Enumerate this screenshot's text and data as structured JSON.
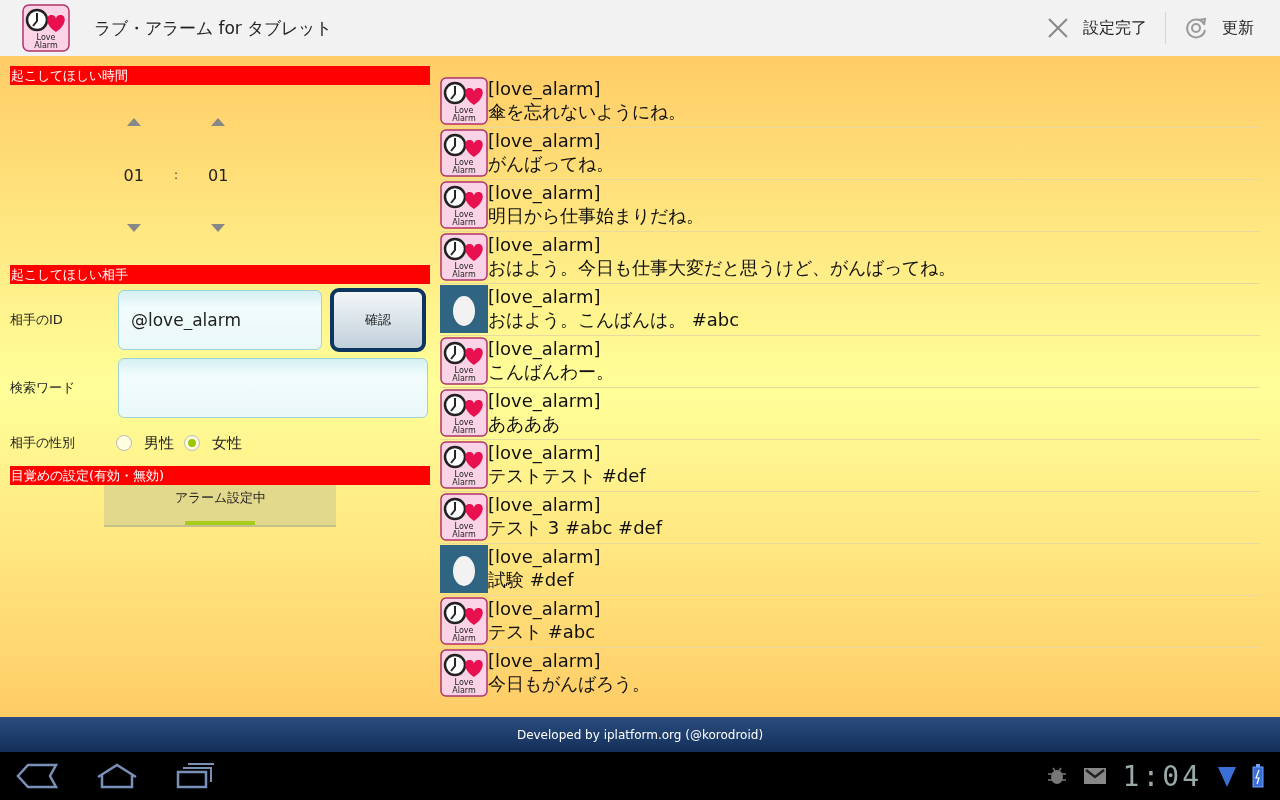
{
  "action_bar": {
    "app_icon_text": [
      "Love",
      "Alarm"
    ],
    "title": "ラブ・アラーム for タブレット",
    "actions": [
      {
        "kind": "close",
        "label": "設定完了"
      },
      {
        "kind": "refresh",
        "label": "更新"
      }
    ]
  },
  "wake_time": {
    "header": "起こしてほしい時間",
    "hour": "01",
    "separator": ":",
    "minute": "01"
  },
  "partner": {
    "header": "起こしてほしい相手",
    "id_label": "相手のID",
    "id_value": "@love_alarm",
    "confirm_button": "確認",
    "search_label": "検索ワード",
    "gender_label": "相手の性別",
    "genders": [
      {
        "label": "男性",
        "selected": false
      },
      {
        "label": "女性",
        "selected": true
      }
    ]
  },
  "alarm": {
    "header": "目覚めの設定(有効・無効)",
    "toggle_label": "アラーム設定中",
    "on": true
  },
  "tweets": [
    {
      "avatar": {
        "kind": "logo",
        "lines": [
          "Love",
          "Alarm"
        ]
      },
      "user": "[love_alarm]",
      "text": "傘を忘れないようにね。"
    },
    {
      "avatar": {
        "kind": "logo",
        "lines": [
          "Love",
          "Alarm"
        ]
      },
      "user": "[love_alarm]",
      "text": "がんばってね。"
    },
    {
      "avatar": {
        "kind": "logo",
        "lines": [
          "Love",
          "Alarm"
        ]
      },
      "user": "[love_alarm]",
      "text": "明日から仕事始まりだね。"
    },
    {
      "avatar": {
        "kind": "logo",
        "lines": [
          "Love",
          "Alarm"
        ]
      },
      "user": "[love_alarm]",
      "text": "おはよう。今日も仕事大変だと思うけど、がんばってね。"
    },
    {
      "avatar": {
        "kind": "egg"
      },
      "user": "[love_alarm]",
      "text": "おはよう。こんばんは。 #abc"
    },
    {
      "avatar": {
        "kind": "logo",
        "lines": [
          "Love",
          "Alarm"
        ]
      },
      "user": "[love_alarm]",
      "text": "こんばんわー。"
    },
    {
      "avatar": {
        "kind": "logo",
        "lines": [
          "Love",
          "Alarm"
        ]
      },
      "user": "[love_alarm]",
      "text": "ああああ"
    },
    {
      "avatar": {
        "kind": "logo",
        "lines": [
          "Love",
          "Alarm"
        ]
      },
      "user": "[love_alarm]",
      "text": "テストテスト #def"
    },
    {
      "avatar": {
        "kind": "logo",
        "lines": [
          "Love",
          "Alarm"
        ]
      },
      "user": "[love_alarm]",
      "text": "テスト 3  #abc #def"
    },
    {
      "avatar": {
        "kind": "egg"
      },
      "user": "[love_alarm]",
      "text": "試験 #def"
    },
    {
      "avatar": {
        "kind": "logo",
        "lines": [
          "Love",
          "Alarm"
        ]
      },
      "user": "[love_alarm]",
      "text": "テスト #abc"
    },
    {
      "avatar": {
        "kind": "logo",
        "lines": [
          "Love",
          "Alarm"
        ]
      },
      "user": "[love_alarm]",
      "text": "今日もがんばろう。"
    }
  ],
  "footer": "Developed by iplatform.org (@korodroid)",
  "system_bar": {
    "time": "1:04"
  }
}
